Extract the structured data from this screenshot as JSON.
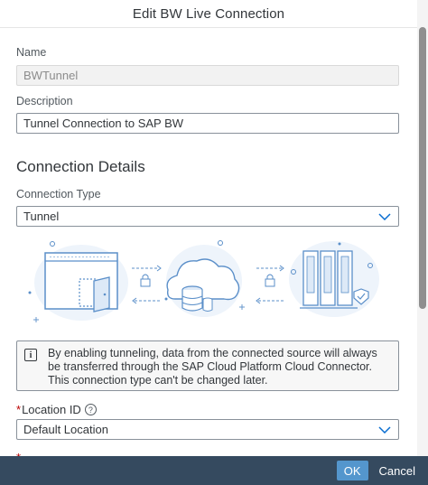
{
  "dialog": {
    "title": "Edit BW Live Connection",
    "name_label": "Name",
    "name_value": "BWTunnel",
    "description_label": "Description",
    "description_value": "Tunnel Connection to SAP BW",
    "section_title": "Connection Details",
    "connection_type_label": "Connection Type",
    "connection_type_value": "Tunnel",
    "info_text": "By enabling tunneling, data from the connected source will always be transferred through the SAP Cloud Platform Cloud Connector. This connection type can't be changed later.",
    "location_label": "Location ID",
    "location_required_mark": "*",
    "location_value": "Default Location",
    "next_required_mark": "*"
  },
  "footer": {
    "ok_label": "OK",
    "cancel_label": "Cancel"
  },
  "icons": {
    "chevron": "chevron-down-icon",
    "info": "info-icon",
    "help": "help-circle-icon"
  },
  "colors": {
    "footer_bg": "#354a5f",
    "ok_button": "#5496cd",
    "required": "#bb0000",
    "illustration_accent": "#5b8fc9"
  }
}
